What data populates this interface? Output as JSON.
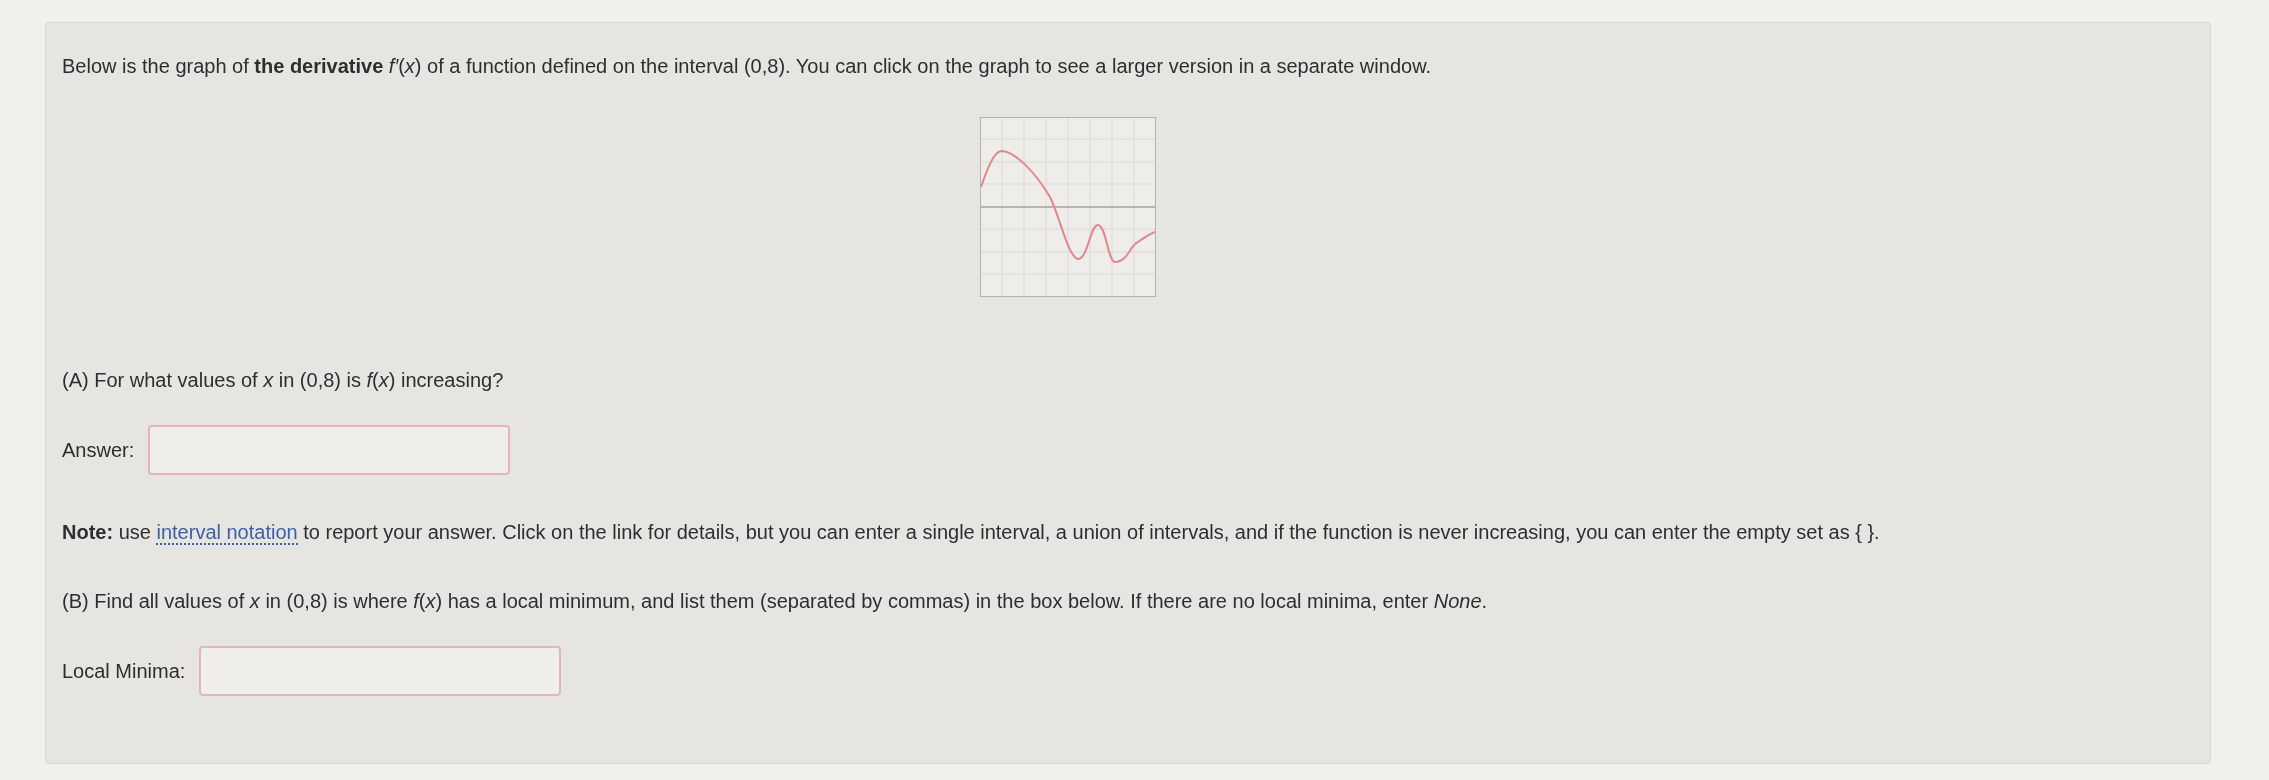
{
  "intro": "Below is the graph of **the derivative** *f′*(*x*) of a function defined on the interval (0,8). You can click on the graph to see a larger version in a separate window.",
  "part_a": {
    "question": "(A) For what values of *x* in (0,8) is *f*(*x*) increasing?",
    "answer_label": "Answer:"
  },
  "note": {
    "lead": "Note:",
    "before_link": "use",
    "link": "interval notation",
    "after_link": "to report your answer. Click on the link for details, but you can enter a single interval, a union of intervals, and if the function is never increasing, you can enter the empty set as { }."
  },
  "part_b": {
    "question": "(B) Find all values of *x* in (0,8) is where *f*(*x*) has a local minimum, and list them (separated by commas) in the box below. If there are no local minima, enter *None*.",
    "answer_label": "Local Minima:"
  }
}
